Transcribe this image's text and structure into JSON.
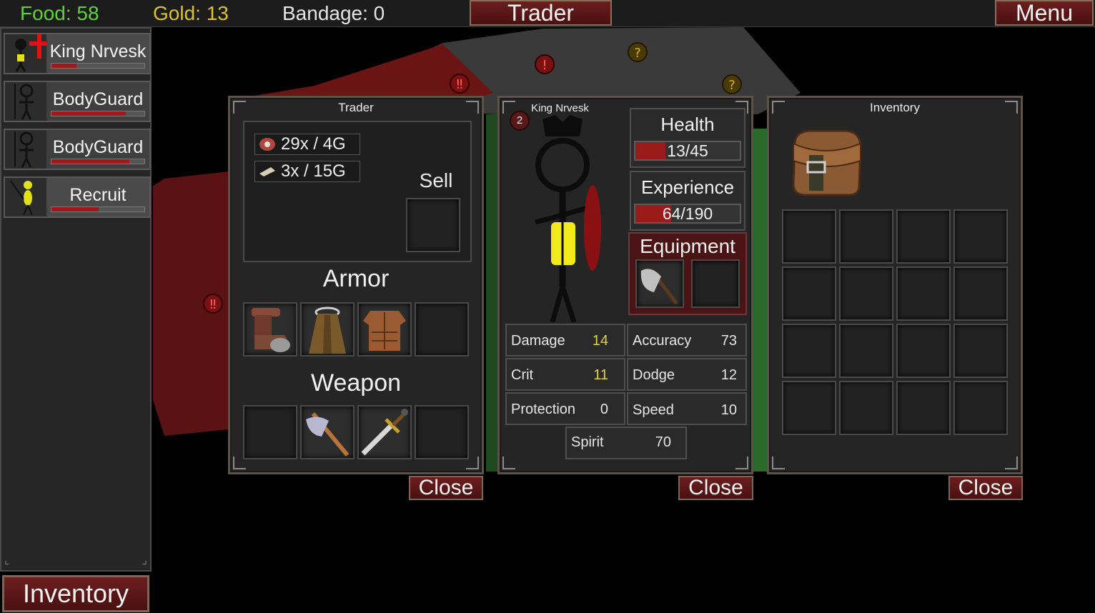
{
  "topbar": {
    "food": "Food: 58",
    "gold": "Gold: 13",
    "bandage": "Bandage: 0",
    "trader_button": "Trader",
    "menu_button": "Menu"
  },
  "party": [
    {
      "name": "King Nrvesk",
      "health_fraction": 0.27
    },
    {
      "name": "BodyGuard",
      "health_fraction": 0.8
    },
    {
      "name": "BodyGuard",
      "health_fraction": 0.84
    },
    {
      "name": "Recruit",
      "health_fraction": 0.51
    }
  ],
  "inventory_button": "Inventory",
  "trader": {
    "title": "Trader",
    "items": [
      {
        "icon": "meat-icon",
        "label": "29x / 4G"
      },
      {
        "icon": "bandage-icon",
        "label": "3x / 15G"
      }
    ],
    "sell_label": "Sell",
    "armor_heading": "Armor",
    "armor_slots": [
      "leather-boots-icon",
      "cloak-icon",
      "chest-armor-icon",
      "empty"
    ],
    "weapon_heading": "Weapon",
    "weapon_slots": [
      "empty",
      "axe-icon",
      "sword-icon",
      "empty"
    ],
    "close": "Close"
  },
  "character": {
    "name": "King Nrvesk",
    "level": "2",
    "health_heading": "Health",
    "health_value": "13/45",
    "health_fraction": 0.29,
    "experience_heading": "Experience",
    "experience_value": "64/190",
    "experience_fraction": 0.34,
    "equipment_heading": "Equipment",
    "equipment_slots": [
      "axe-icon",
      "empty"
    ],
    "stats": [
      {
        "label": "Damage",
        "value": "14",
        "highlight": true
      },
      {
        "label": "Accuracy",
        "value": "73",
        "highlight": false
      },
      {
        "label": "Crit",
        "value": "11",
        "highlight": true
      },
      {
        "label": "Dodge",
        "value": "12",
        "highlight": false
      },
      {
        "label": "Protection",
        "value": "0",
        "highlight": false
      },
      {
        "label": "Speed",
        "value": "10",
        "highlight": false
      },
      {
        "label": "Spirit",
        "value": "70",
        "highlight": false
      }
    ],
    "close": "Close"
  },
  "inventory": {
    "title": "Inventory",
    "bag_icon": "backpack-icon",
    "close": "Close"
  },
  "colors": {
    "food": "#5fd13b",
    "gold": "#d9c22e",
    "button_red": "#6b1e1e",
    "health_bar": "#9b1a1a",
    "highlight_stat": "#e9d23a"
  }
}
